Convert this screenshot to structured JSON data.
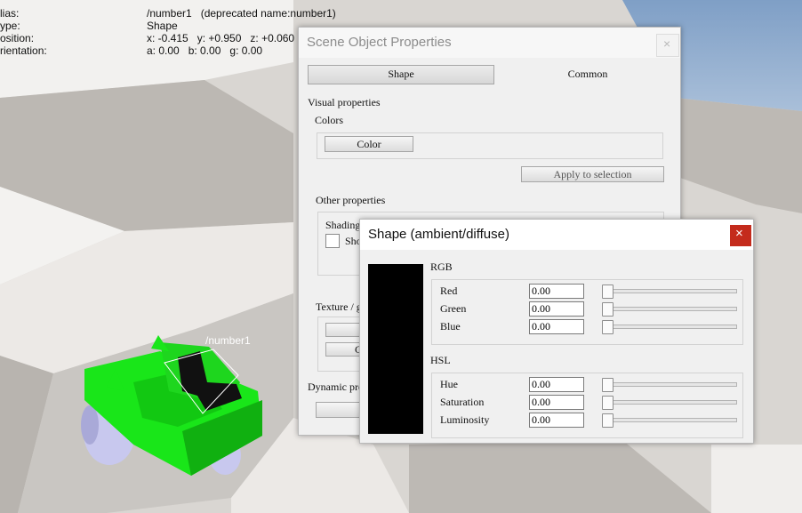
{
  "scene_info": {
    "alias_label": "lias:",
    "alias_value": "/number1   (deprecated name:number1)",
    "type_label": "ype:",
    "type_value": "Shape",
    "position_label": "osition:",
    "position_value": "x: -0.415   y: +0.950   z: +0.060",
    "orientation_label": "rientation:",
    "orientation_value": "a: 0.00   b: 0.00   g: 0.00"
  },
  "object_label": "/number1",
  "props_dialog": {
    "title": "Scene Object Properties",
    "close_glyph": "×",
    "tabs": [
      "Shape",
      "Common"
    ],
    "visual_properties": "Visual properties",
    "colors_group": "Colors",
    "color_button": "Color",
    "apply_button": "Apply to selection",
    "other_properties": "Other properties",
    "shading_label": "Shading",
    "show_label_partial": "Sho",
    "texture_label": "Texture / g",
    "c_button_partial": "C",
    "dynamic_label": "Dynamic pro"
  },
  "color_dialog": {
    "title": "Shape (ambient/diffuse)",
    "close_glyph": "×",
    "swatch_color": "#000000",
    "rgb_heading": "RGB",
    "hsl_heading": "HSL",
    "rgb": [
      {
        "label": "Red",
        "value": "0.00",
        "level": 0
      },
      {
        "label": "Green",
        "value": "0.00",
        "level": 0
      },
      {
        "label": "Blue",
        "value": "0.00",
        "level": 0
      }
    ],
    "hsl": [
      {
        "label": "Hue",
        "value": "0.00",
        "level": 0
      },
      {
        "label": "Saturation",
        "value": "0.00",
        "level": 0
      },
      {
        "label": "Luminosity",
        "value": "0.00",
        "level": 0
      }
    ]
  },
  "colors": {
    "close_red": "#c42b1c",
    "robot_green": "#19e619"
  }
}
